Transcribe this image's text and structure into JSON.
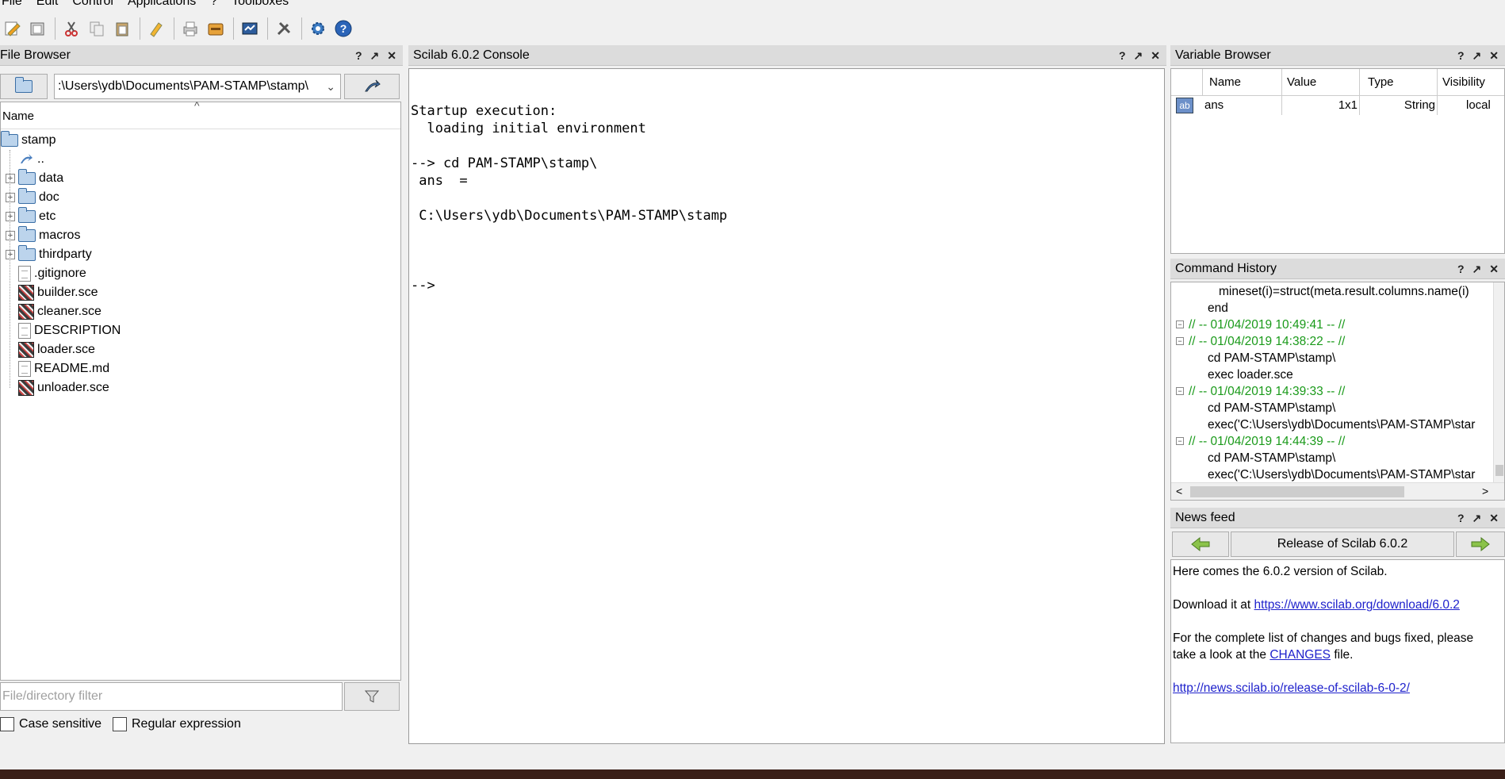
{
  "menubar": {
    "items": [
      "File",
      "Edit",
      "Control",
      "Applications",
      "?",
      "Toolboxes"
    ]
  },
  "toolbar": {
    "buttons": [
      "new-script-icon",
      "open-file-icon",
      "cut-icon",
      "copy-icon",
      "paste-icon",
      "clear-console-icon",
      "print-icon",
      "module-manager-icon",
      "xcos-icon",
      "preferences-icon",
      "gear-icon",
      "help-icon"
    ]
  },
  "file_browser": {
    "title": "File Browser",
    "path": ":\\Users\\ydb\\Documents\\PAM-STAMP\\stamp\\",
    "column": "Name",
    "root": "stamp",
    "items": [
      {
        "label": "..",
        "kind": "up"
      },
      {
        "label": "data",
        "kind": "folder"
      },
      {
        "label": "doc",
        "kind": "folder"
      },
      {
        "label": "etc",
        "kind": "folder"
      },
      {
        "label": "macros",
        "kind": "folder"
      },
      {
        "label": "thirdparty",
        "kind": "folder"
      },
      {
        "label": ".gitignore",
        "kind": "file"
      },
      {
        "label": "builder.sce",
        "kind": "sce"
      },
      {
        "label": "cleaner.sce",
        "kind": "sce"
      },
      {
        "label": "DESCRIPTION",
        "kind": "file"
      },
      {
        "label": "loader.sce",
        "kind": "sce"
      },
      {
        "label": "README.md",
        "kind": "file"
      },
      {
        "label": "unloader.sce",
        "kind": "sce"
      }
    ],
    "filter_placeholder": "File/directory filter",
    "case_sensitive": "Case sensitive",
    "regex": "Regular expression"
  },
  "console": {
    "title": "Scilab 6.0.2 Console",
    "lines": [
      "Startup execution:",
      "  loading initial environment",
      "",
      "--> cd PAM-STAMP\\stamp\\",
      " ans  =",
      "",
      " C:\\Users\\ydb\\Documents\\PAM-STAMP\\stamp",
      "",
      "",
      "",
      "-->"
    ]
  },
  "variable_browser": {
    "title": "Variable Browser",
    "columns": [
      "Name",
      "Value",
      "Type",
      "Visibility"
    ],
    "rows": [
      {
        "name": "ans",
        "value": "1x1",
        "type": "String",
        "visibility": "local",
        "icon": "ab"
      }
    ]
  },
  "command_history": {
    "title": "Command History",
    "lines": [
      {
        "text": "mineset(i)=struct(meta.result.columns.name(i)",
        "level": 2,
        "color": "#000000"
      },
      {
        "text": "end",
        "level": 1,
        "color": "#000000"
      },
      {
        "text": "// -- 01/04/2019 10:49:41 -- //",
        "level": 0,
        "color": "#1a9a1a"
      },
      {
        "text": "// -- 01/04/2019 14:38:22 -- //",
        "level": 0,
        "color": "#1a9a1a"
      },
      {
        "text": "cd PAM-STAMP\\stamp\\",
        "level": 1,
        "color": "#000000"
      },
      {
        "text": "exec loader.sce",
        "level": 1,
        "color": "#000000"
      },
      {
        "text": "// -- 01/04/2019 14:39:33 -- //",
        "level": 0,
        "color": "#1a9a1a"
      },
      {
        "text": "cd PAM-STAMP\\stamp\\",
        "level": 1,
        "color": "#000000"
      },
      {
        "text": "exec('C:\\Users\\ydb\\Documents\\PAM-STAMP\\star",
        "level": 1,
        "color": "#000000"
      },
      {
        "text": "// -- 01/04/2019 14:44:39 -- //",
        "level": 0,
        "color": "#1a9a1a"
      },
      {
        "text": "cd PAM-STAMP\\stamp\\",
        "level": 1,
        "color": "#000000"
      },
      {
        "text": "exec('C:\\Users\\ydb\\Documents\\PAM-STAMP\\star",
        "level": 1,
        "color": "#000000"
      }
    ]
  },
  "news_feed": {
    "title": "News feed",
    "headline": "Release of Scilab 6.0.2",
    "p1": "Here comes the 6.0.2 version of Scilab.",
    "p2_prefix": "Download it at ",
    "p2_link": "https://www.scilab.org/download/6.0.2",
    "p3a": "For the complete list of changes and bugs fixed, please",
    "p3b_prefix": "take a look at the ",
    "p3b_link": "CHANGES",
    "p3b_suffix": " file.",
    "p4_link": "http://news.scilab.io/release-of-scilab-6-0-2/"
  },
  "panel_controls": {
    "help": "?",
    "undock": "↗",
    "close": "✕"
  }
}
